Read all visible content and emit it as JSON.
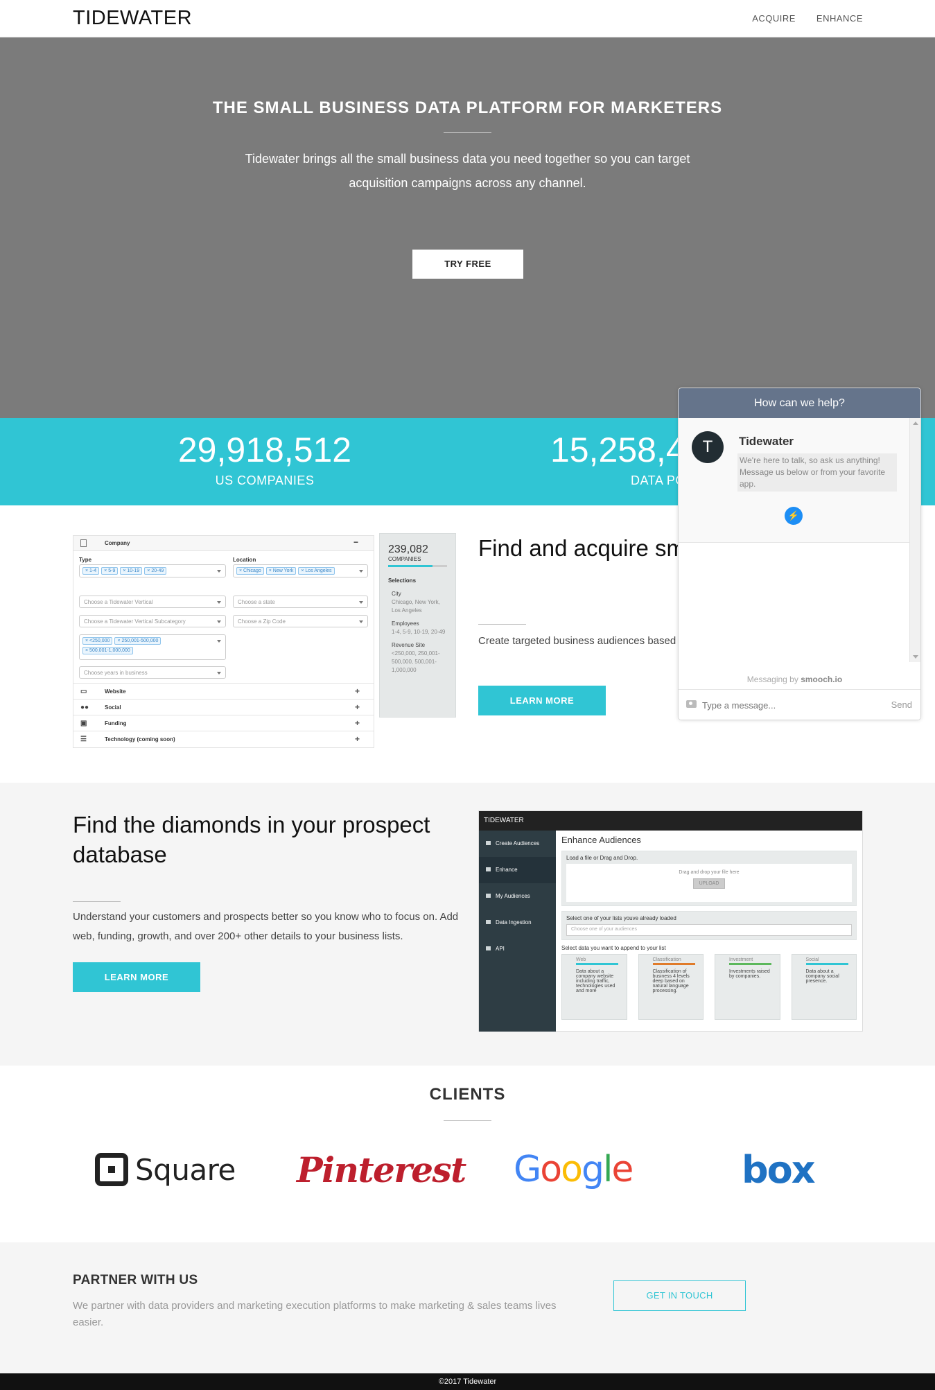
{
  "nav": {
    "logo": "TIDEWATER",
    "links": [
      "ACQUIRE",
      "ENHANCE"
    ]
  },
  "hero": {
    "title": "THE SMALL BUSINESS DATA PLATFORM FOR MARKETERS",
    "subtitle": "Tidewater brings all the small business data you need together so you can target acquisition campaigns across any channel.",
    "cta": "TRY FREE"
  },
  "stats": [
    {
      "value": "29,918,512",
      "label": "US COMPANIES"
    },
    {
      "value": "15,258,4",
      "label": "DATA PO"
    }
  ],
  "acquire": {
    "title": "Find and acquire sm customers smarter",
    "body": "Create targeted business audiences based mail, Facebook, or LinkedIn campaigns.",
    "cta": "LEARN MORE",
    "screenshot": {
      "company_header": "Company",
      "type_label": "Type",
      "type_chips": [
        "1-4",
        "5-9",
        "10-19",
        "20-49"
      ],
      "location_label": "Location",
      "location_chips": [
        "Chicago",
        "New York",
        "Los Angeles"
      ],
      "vertical_placeholder": "Choose a Tidewater Vertical",
      "subcategory_placeholder": "Choose a Tidewater Vertical Subcategory",
      "state_placeholder": "Choose a state",
      "zip_placeholder": "Choose a Zip Code",
      "revenue_chips": [
        "<250,000",
        "250,001-500,000",
        "500,001-1,000,000"
      ],
      "years_placeholder": "Choose years in business",
      "rows": [
        "Website",
        "Social",
        "Funding",
        "Technology (coming soon)"
      ],
      "count": "239,082",
      "count_label": "COMPANIES",
      "selections_label": "Selections",
      "city_label": "City",
      "city_value": "Chicago, New York, Los Angeles",
      "employees_label": "Employees",
      "employees_value": "1-4, 5-9, 10-19, 20-49",
      "revenue_label": "Revenue Site",
      "revenue_value": "<250,000, 250,001-500,000, 500,001-1,000,000"
    }
  },
  "enhance": {
    "title": "Find the diamonds in your prospect database",
    "body": "Understand your customers and prospects better so you know who to focus on. Add web, funding, growth, and over 200+ other details to your business lists.",
    "cta": "LEARN MORE",
    "screenshot": {
      "brand": "TIDEWATER",
      "menu": [
        "Create Audiences",
        "Enhance",
        "My Audiences",
        "Data Ingestion",
        "API"
      ],
      "heading": "Enhance Audiences",
      "load_label": "Load a file or Drag and Drop.",
      "drop_text": "Drag and drop your file here",
      "upload": "UPLOAD",
      "select_label": "Select one of your lists youve already loaded",
      "select_placeholder": "Choose one of your audiences",
      "append_label": "Select data you want to append to your list",
      "cards": [
        {
          "title": "Web",
          "text": "Data about a company website including traffic, technologies used and more",
          "color": "#30c5d4"
        },
        {
          "title": "Classification",
          "text": "Classification of business 4 levels deep based on natural language processing.",
          "color": "#e07b2a"
        },
        {
          "title": "Investment",
          "text": "Investments raised by companies.",
          "color": "#5cb85c"
        },
        {
          "title": "Social",
          "text": "Data about a company social presence.",
          "color": "#30c5d4"
        }
      ]
    }
  },
  "clients": {
    "title": "CLIENTS",
    "logos": [
      "Square",
      "Pinterest",
      "Google",
      "box"
    ]
  },
  "partner": {
    "title": "PARTNER WITH US",
    "body": "We partner with data providers and marketing execution platforms to make marketing & sales teams lives easier.",
    "cta": "GET IN TOUCH"
  },
  "footer": {
    "text": "©2017 Tidewater"
  },
  "chat": {
    "header": "How can we help?",
    "avatar_letter": "T",
    "name": "Tidewater",
    "message": "We're here to talk, so ask us anything! Message us below or from your favorite app.",
    "powered_prefix": "Messaging by",
    "powered_brand": "smooch.io",
    "input_placeholder": "Type a message...",
    "send": "Send"
  },
  "colors": {
    "accent": "#30c5d4",
    "hero_bg": "#7b7b7b",
    "chat_header": "#65748b",
    "footer_bg": "#111111"
  }
}
